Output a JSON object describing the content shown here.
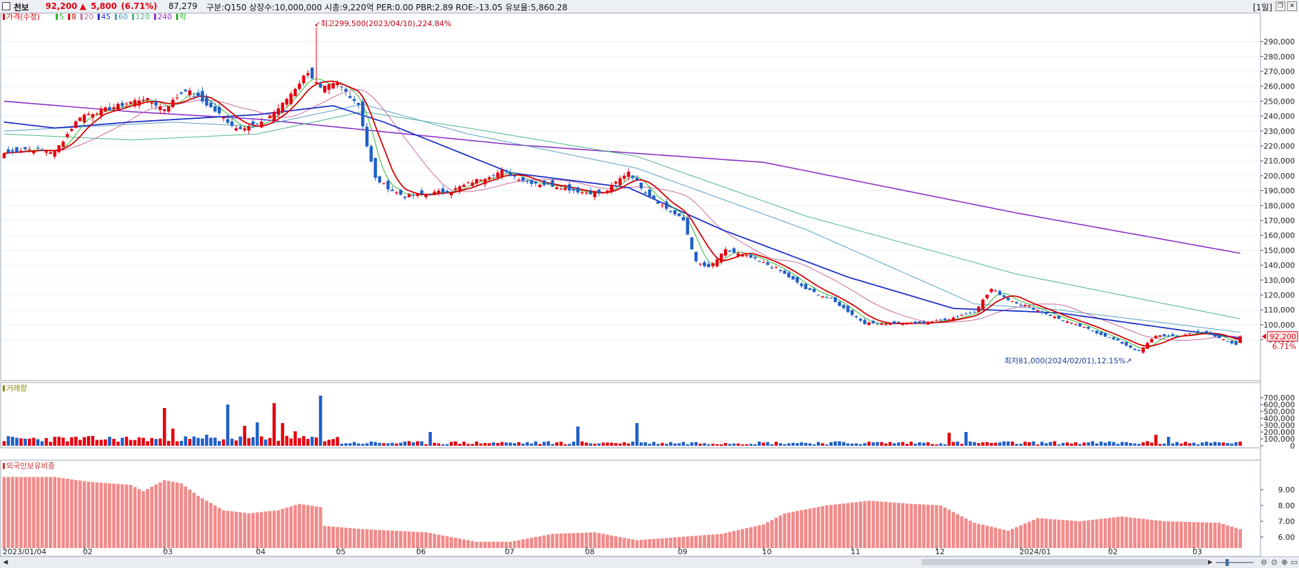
{
  "header": {
    "stock_name": "천보",
    "price": "92,200",
    "change_arrow": "▲",
    "change": "5,800",
    "change_pct": "(6.71%)",
    "volume": "87,279",
    "info": "구분:Q150  상장수:10,000,000  시총:9,220억  PER:0.00  PBR:2.89  ROE:-13.05  유보율:5,860.28",
    "period_button": "[1일]"
  },
  "colors": {
    "up": "#e4000e",
    "down": "#1f5fc9",
    "ma5": "#2db52d",
    "ma8": "#d40000",
    "ma20": "#c86aa0",
    "ma45": "#1d31c9",
    "ma60": "#55a0c4",
    "ma120": "#4fb587",
    "ma240": "#8a2fc4",
    "foreign": "#f28a8a"
  },
  "chart_data": [
    {
      "type": "candlestick",
      "panel": "price",
      "legend": [
        {
          "label": "가격(수정)",
          "color": "#e4000e"
        },
        {
          "label": "5",
          "color": "#2db52d"
        },
        {
          "label": "8",
          "color": "#d40000"
        },
        {
          "label": "20",
          "color": "#c86aa0"
        },
        {
          "label": "45",
          "color": "#1d31c9"
        },
        {
          "label": "60",
          "color": "#55a0c4"
        },
        {
          "label": "120",
          "color": "#4fb587"
        },
        {
          "label": "240",
          "color": "#8a2fc4"
        },
        {
          "label": "락",
          "color": "#2db52d"
        }
      ],
      "ylim": [
        70000,
        305000
      ],
      "y_ticks": [
        "290,000",
        "280,000",
        "270,000",
        "260,000",
        "250,000",
        "240,000",
        "230,000",
        "220,000",
        "210,000",
        "200,000",
        "190,000",
        "180,000",
        "170,000",
        "160,000",
        "150,000",
        "140,000",
        "130,000",
        "120,000",
        "110,000",
        "100,000",
        "90,000"
      ],
      "x_ticks": [
        "2023/01/04",
        "02",
        "03",
        "04",
        "05",
        "06",
        "07",
        "08",
        "09",
        "10",
        "11",
        "12",
        "2024/01",
        "02",
        "03"
      ],
      "close_anchors": [
        [
          0,
          215000
        ],
        [
          5,
          218000
        ],
        [
          12,
          216000
        ],
        [
          18,
          240000
        ],
        [
          26,
          246000
        ],
        [
          33,
          252000
        ],
        [
          38,
          245000
        ],
        [
          43,
          258000
        ],
        [
          48,
          248000
        ],
        [
          55,
          232000
        ],
        [
          61,
          235000
        ],
        [
          66,
          248000
        ],
        [
          72,
          270000
        ],
        [
          75,
          258000
        ],
        [
          79,
          262000
        ],
        [
          84,
          248000
        ],
        [
          86,
          220000
        ],
        [
          88,
          198000
        ],
        [
          92,
          190000
        ],
        [
          95,
          186000
        ],
        [
          100,
          188000
        ],
        [
          106,
          190000
        ],
        [
          111,
          196000
        ],
        [
          118,
          203000
        ],
        [
          124,
          196000
        ],
        [
          131,
          193000
        ],
        [
          137,
          189000
        ],
        [
          142,
          188000
        ],
        [
          148,
          203000
        ],
        [
          152,
          189000
        ],
        [
          156,
          180000
        ],
        [
          161,
          170000
        ],
        [
          164,
          142000
        ],
        [
          167,
          138000
        ],
        [
          171,
          150000
        ],
        [
          176,
          146000
        ],
        [
          183,
          138000
        ],
        [
          190,
          124000
        ],
        [
          196,
          117000
        ],
        [
          200,
          109000
        ],
        [
          204,
          101000
        ],
        [
          210,
          101000
        ],
        [
          217,
          101000
        ],
        [
          224,
          104000
        ],
        [
          230,
          109000
        ],
        [
          234,
          124000
        ],
        [
          238,
          117000
        ],
        [
          243,
          112000
        ],
        [
          250,
          104000
        ],
        [
          257,
          97000
        ],
        [
          264,
          89000
        ],
        [
          269,
          82000
        ],
        [
          273,
          93000
        ],
        [
          278,
          92000
        ],
        [
          283,
          96000
        ],
        [
          288,
          91000
        ],
        [
          292,
          87000
        ],
        [
          293,
          92200
        ]
      ],
      "last_price": "92,200",
      "last_change_pct": "6.71%",
      "high_annotation": "최고299,500(2023/04/10),224.84%",
      "low_annotation": "최저81,000(2024/02/01),12.15%",
      "ma240_anchors": [
        [
          0,
          250000
        ],
        [
          30,
          243000
        ],
        [
          60,
          238000
        ],
        [
          120,
          221000
        ],
        [
          180,
          209000
        ],
        [
          240,
          175000
        ],
        [
          293,
          148000
        ]
      ],
      "ma120_anchors": [
        [
          0,
          228000
        ],
        [
          30,
          224000
        ],
        [
          60,
          228000
        ],
        [
          85,
          243000
        ],
        [
          110,
          232000
        ],
        [
          150,
          213000
        ],
        [
          190,
          173000
        ],
        [
          240,
          134000
        ],
        [
          293,
          104000
        ]
      ],
      "ma60_anchors": [
        [
          0,
          230000
        ],
        [
          40,
          236000
        ],
        [
          60,
          233000
        ],
        [
          85,
          248000
        ],
        [
          110,
          228000
        ],
        [
          150,
          205000
        ],
        [
          190,
          164000
        ],
        [
          230,
          114000
        ],
        [
          250,
          110000
        ],
        [
          293,
          95000
        ]
      ],
      "ma45_anchors": [
        [
          0,
          236000
        ],
        [
          12,
          232000
        ],
        [
          30,
          236000
        ],
        [
          60,
          241000
        ],
        [
          78,
          247000
        ],
        [
          90,
          236000
        ],
        [
          120,
          202000
        ],
        [
          148,
          192000
        ],
        [
          170,
          164000
        ],
        [
          200,
          132000
        ],
        [
          225,
          111000
        ],
        [
          250,
          108000
        ],
        [
          280,
          96000
        ],
        [
          293,
          91000
        ]
      ]
    },
    {
      "type": "bar",
      "panel": "volume",
      "legend": [
        {
          "label": "거래량",
          "color": "#888800"
        }
      ],
      "ylim": [
        0,
        760000
      ],
      "y_ticks": [
        "700,000",
        "600,000",
        "500,000",
        "400,000",
        "300,000",
        "200,000",
        "100,000",
        "0"
      ],
      "spikes": [
        [
          38,
          550000
        ],
        [
          40,
          250000
        ],
        [
          48,
          160000
        ],
        [
          53,
          600000
        ],
        [
          57,
          290000
        ],
        [
          60,
          340000
        ],
        [
          64,
          620000
        ],
        [
          66,
          330000
        ],
        [
          69,
          210000
        ],
        [
          75,
          730000
        ],
        [
          101,
          200000
        ],
        [
          136,
          280000
        ],
        [
          150,
          330000
        ],
        [
          224,
          190000
        ],
        [
          228,
          200000
        ],
        [
          273,
          160000
        ],
        [
          276,
          130000
        ]
      ]
    },
    {
      "type": "bar",
      "panel": "foreign_ratio",
      "legend": [
        {
          "label": "외국인보유비중",
          "color": "#cc3333"
        }
      ],
      "ylim": [
        5.3,
        10.3
      ],
      "y_ticks": [
        "9.00",
        "8.00",
        "7.00",
        "6.00"
      ],
      "anchors": [
        [
          0,
          9.8
        ],
        [
          12,
          9.8
        ],
        [
          20,
          9.5
        ],
        [
          30,
          9.3
        ],
        [
          33,
          8.9
        ],
        [
          38,
          9.6
        ],
        [
          42,
          9.4
        ],
        [
          46,
          8.6
        ],
        [
          52,
          7.7
        ],
        [
          58,
          7.5
        ],
        [
          65,
          7.7
        ],
        [
          70,
          8.1
        ],
        [
          75,
          7.9
        ],
        [
          76,
          6.7
        ],
        [
          85,
          6.5
        ],
        [
          100,
          6.3
        ],
        [
          112,
          5.7
        ],
        [
          120,
          5.7
        ],
        [
          130,
          6.2
        ],
        [
          140,
          6.3
        ],
        [
          150,
          5.8
        ],
        [
          160,
          6.0
        ],
        [
          170,
          6.2
        ],
        [
          180,
          6.8
        ],
        [
          185,
          7.5
        ],
        [
          195,
          8.0
        ],
        [
          205,
          8.3
        ],
        [
          215,
          8.1
        ],
        [
          222,
          8.0
        ],
        [
          230,
          6.9
        ],
        [
          238,
          6.4
        ],
        [
          245,
          7.2
        ],
        [
          255,
          7.0
        ],
        [
          265,
          7.3
        ],
        [
          275,
          7.0
        ],
        [
          288,
          6.9
        ],
        [
          293,
          6.5
        ]
      ]
    }
  ],
  "footer": {
    "nav_prev": "◀",
    "nav_next": "▶"
  }
}
